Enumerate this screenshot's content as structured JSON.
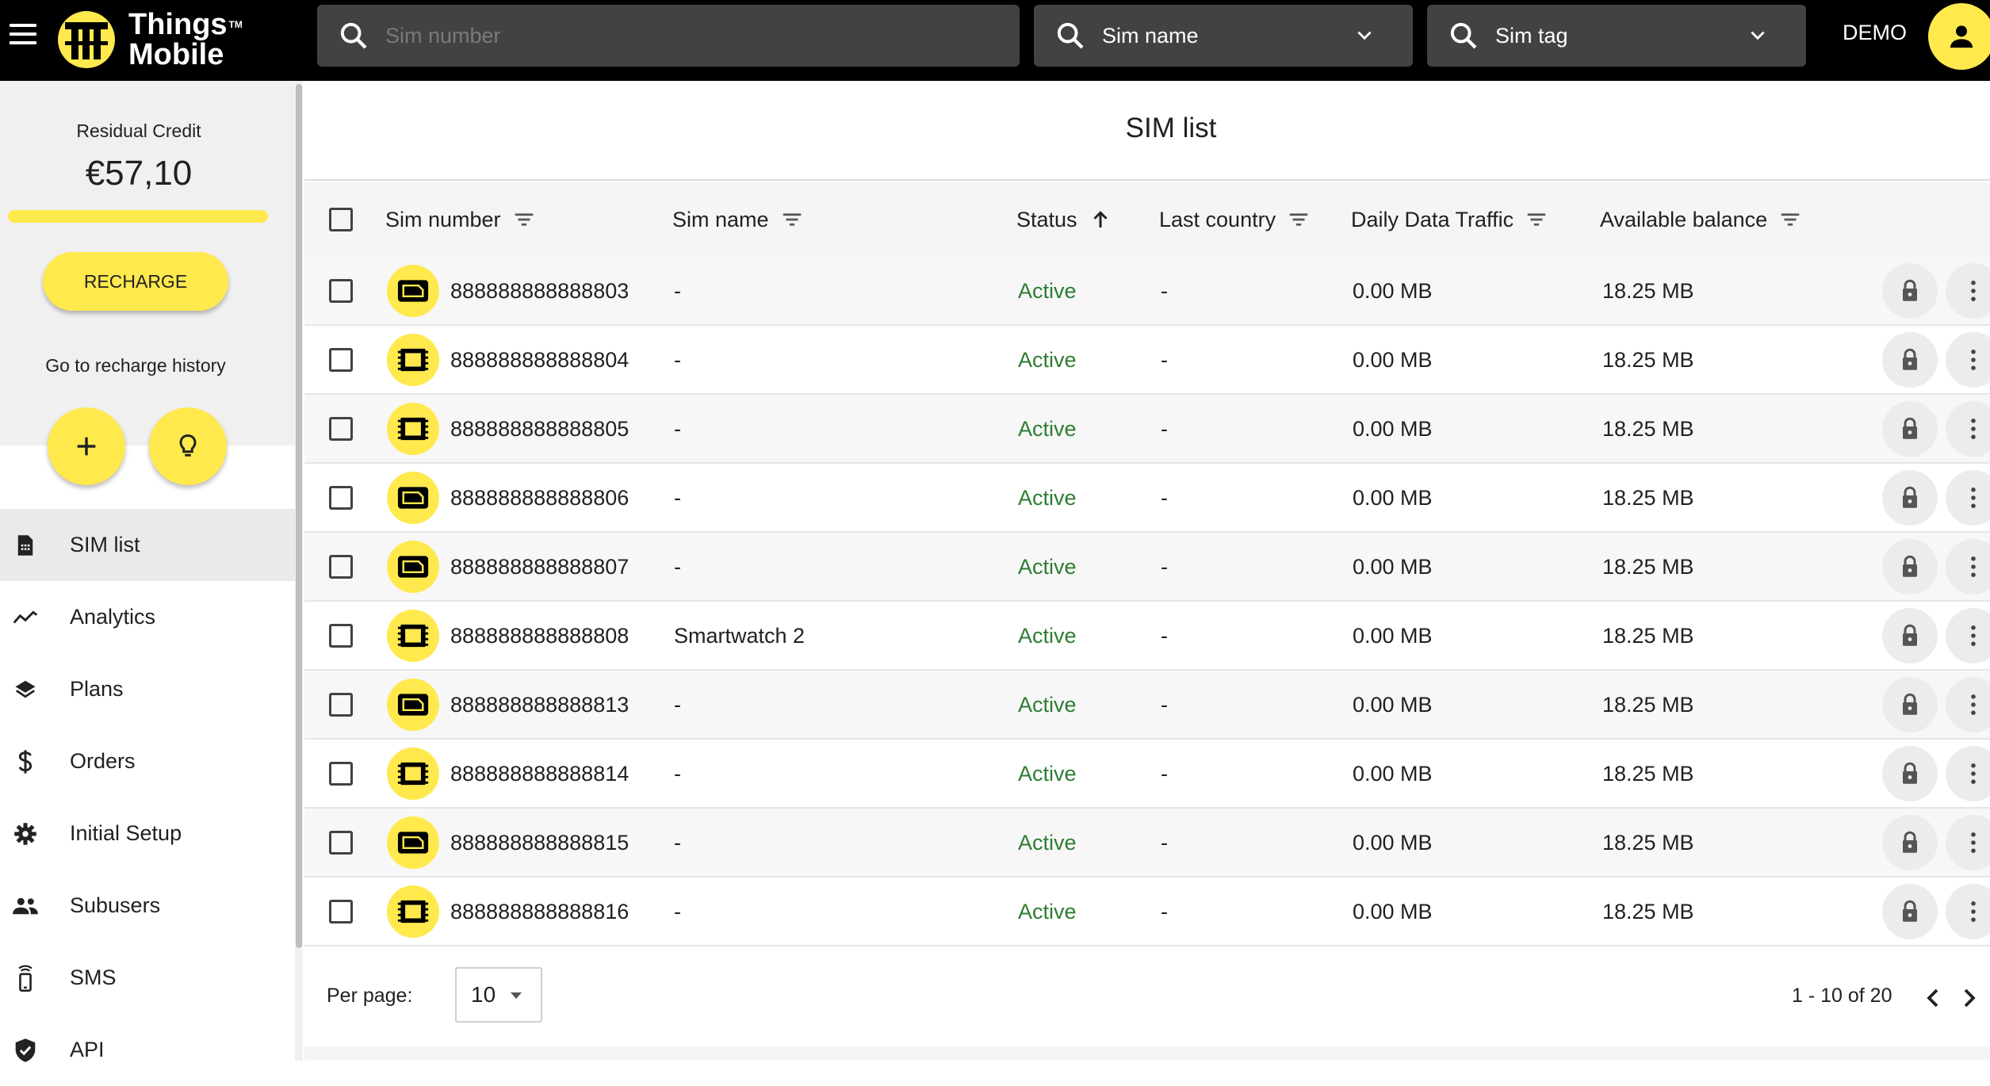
{
  "brand": {
    "line1": "Things",
    "line2": "Mobile",
    "tm": "TM",
    "accent": "#ffe94d"
  },
  "search": {
    "sim_number_placeholder": "Sim number",
    "sim_name_label": "Sim name",
    "sim_tag_label": "Sim tag"
  },
  "user": {
    "name": "DEMO"
  },
  "sidebar": {
    "credit_label": "Residual Credit",
    "credit_value": "€57,10",
    "recharge_label": "RECHARGE",
    "history_link": "Go to recharge history",
    "nav": [
      {
        "label": "SIM list",
        "icon": "sim-card-icon",
        "active": true
      },
      {
        "label": "Analytics",
        "icon": "trend-line-icon",
        "active": false
      },
      {
        "label": "Plans",
        "icon": "layers-icon",
        "active": false
      },
      {
        "label": "Orders",
        "icon": "dollar-icon",
        "active": false
      },
      {
        "label": "Initial Setup",
        "icon": "gear-icon",
        "active": false
      },
      {
        "label": "Subusers",
        "icon": "people-icon",
        "active": false
      },
      {
        "label": "SMS",
        "icon": "phone-message-icon",
        "active": false
      },
      {
        "label": "API",
        "icon": "shield-check-icon",
        "active": false
      }
    ]
  },
  "page": {
    "title": "SIM list",
    "columns": {
      "sim_number": "Sim number",
      "sim_name": "Sim name",
      "status": "Status",
      "last_country": "Last country",
      "daily_traffic": "Daily Data Traffic",
      "balance": "Available balance"
    },
    "status_color": "#2e7d32",
    "rows": [
      {
        "sim_number": "888888888888803",
        "sim_name": "-",
        "status": "Active",
        "last_country": "-",
        "daily_traffic": "0.00 MB",
        "balance": "18.25 MB",
        "sim_type": "nano"
      },
      {
        "sim_number": "888888888888804",
        "sim_name": "-",
        "status": "Active",
        "last_country": "-",
        "daily_traffic": "0.00 MB",
        "balance": "18.25 MB",
        "sim_type": "chip"
      },
      {
        "sim_number": "888888888888805",
        "sim_name": "-",
        "status": "Active",
        "last_country": "-",
        "daily_traffic": "0.00 MB",
        "balance": "18.25 MB",
        "sim_type": "chip"
      },
      {
        "sim_number": "888888888888806",
        "sim_name": "-",
        "status": "Active",
        "last_country": "-",
        "daily_traffic": "0.00 MB",
        "balance": "18.25 MB",
        "sim_type": "nano"
      },
      {
        "sim_number": "888888888888807",
        "sim_name": "-",
        "status": "Active",
        "last_country": "-",
        "daily_traffic": "0.00 MB",
        "balance": "18.25 MB",
        "sim_type": "nano"
      },
      {
        "sim_number": "888888888888808",
        "sim_name": "Smartwatch 2",
        "status": "Active",
        "last_country": "-",
        "daily_traffic": "0.00 MB",
        "balance": "18.25 MB",
        "sim_type": "chip"
      },
      {
        "sim_number": "888888888888813",
        "sim_name": "-",
        "status": "Active",
        "last_country": "-",
        "daily_traffic": "0.00 MB",
        "balance": "18.25 MB",
        "sim_type": "nano"
      },
      {
        "sim_number": "888888888888814",
        "sim_name": "-",
        "status": "Active",
        "last_country": "-",
        "daily_traffic": "0.00 MB",
        "balance": "18.25 MB",
        "sim_type": "chip"
      },
      {
        "sim_number": "888888888888815",
        "sim_name": "-",
        "status": "Active",
        "last_country": "-",
        "daily_traffic": "0.00 MB",
        "balance": "18.25 MB",
        "sim_type": "nano"
      },
      {
        "sim_number": "888888888888816",
        "sim_name": "-",
        "status": "Active",
        "last_country": "-",
        "daily_traffic": "0.00 MB",
        "balance": "18.25 MB",
        "sim_type": "chip"
      }
    ],
    "pagination": {
      "per_page_label": "Per page:",
      "per_page_value": "10",
      "range": "1 - 10 of 20"
    }
  }
}
